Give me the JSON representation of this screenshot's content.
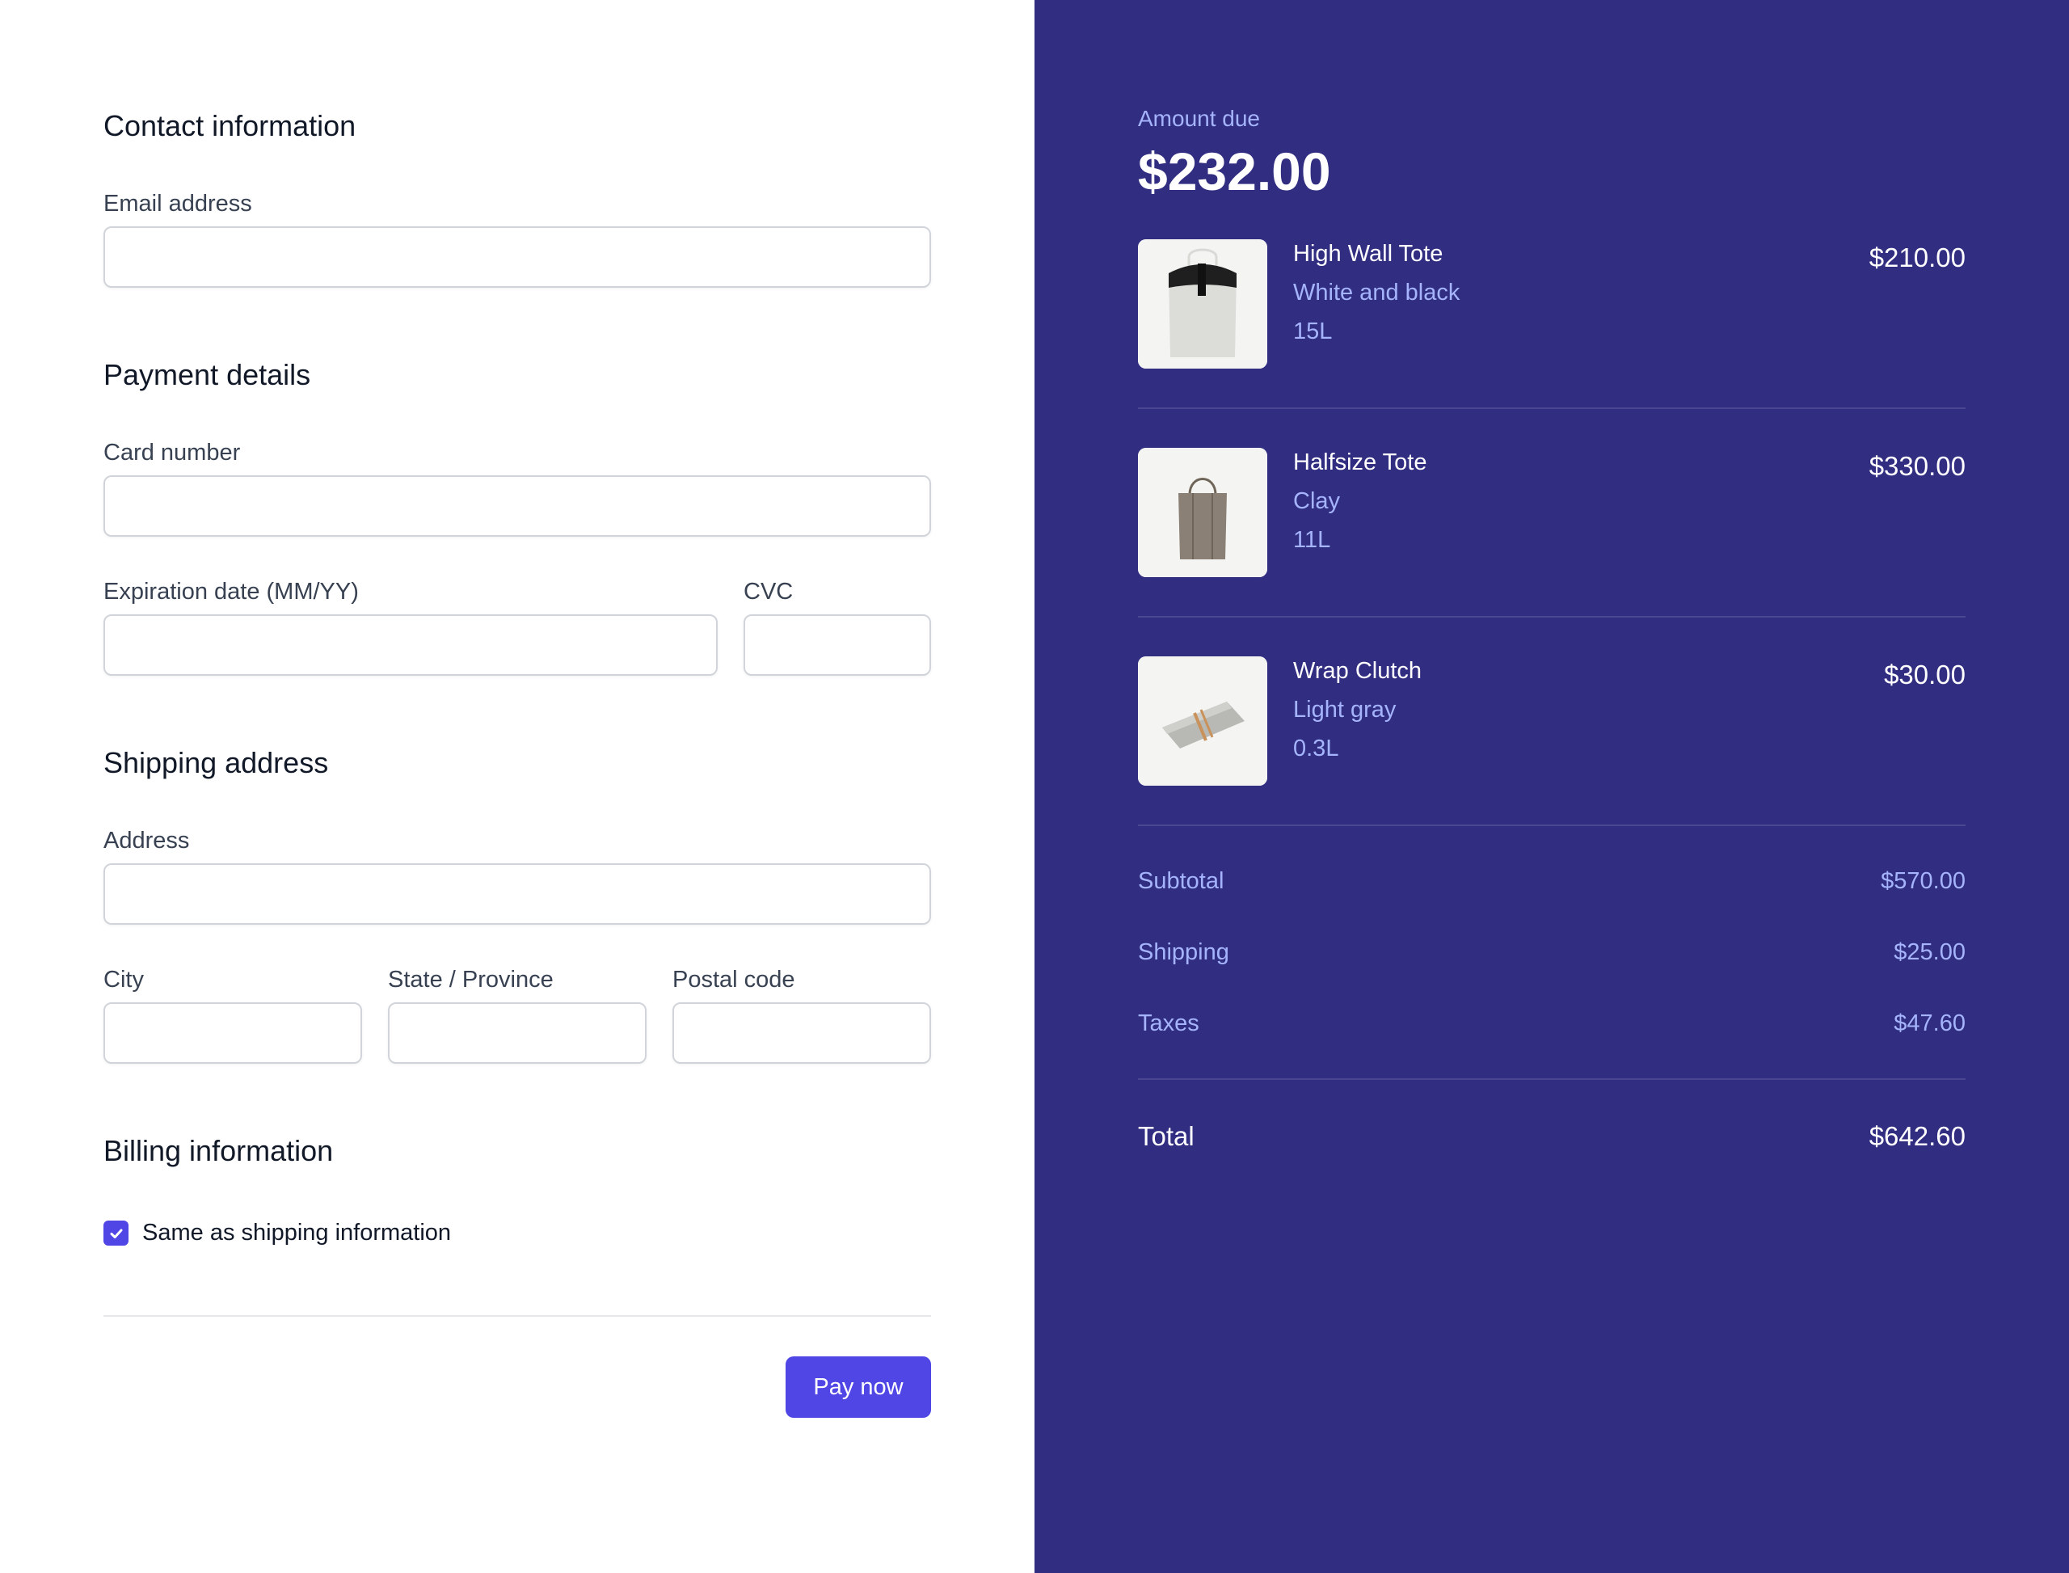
{
  "contact": {
    "title": "Contact information",
    "email_label": "Email address",
    "email_value": ""
  },
  "payment": {
    "title": "Payment details",
    "card_label": "Card number",
    "card_value": "",
    "exp_label": "Expiration date (MM/YY)",
    "exp_value": "",
    "cvc_label": "CVC",
    "cvc_value": ""
  },
  "shipping": {
    "title": "Shipping address",
    "address_label": "Address",
    "address_value": "",
    "city_label": "City",
    "city_value": "",
    "state_label": "State / Province",
    "state_value": "",
    "postal_label": "Postal code",
    "postal_value": ""
  },
  "billing": {
    "title": "Billing information",
    "same_as_shipping_label": "Same as shipping information",
    "same_as_shipping_checked": true
  },
  "actions": {
    "pay_label": "Pay now"
  },
  "summary": {
    "amount_due_label": "Amount due",
    "amount_due_value": "$232.00",
    "items": [
      {
        "name": "High Wall Tote",
        "variant": "White and black",
        "size": "15L",
        "price": "$210.00",
        "icon": "tote-bag-image"
      },
      {
        "name": "Halfsize Tote",
        "variant": "Clay",
        "size": "11L",
        "price": "$330.00",
        "icon": "halfsize-tote-image"
      },
      {
        "name": "Wrap Clutch",
        "variant": "Light gray",
        "size": "0.3L",
        "price": "$30.00",
        "icon": "clutch-image"
      }
    ],
    "subtotal_label": "Subtotal",
    "subtotal_value": "$570.00",
    "shipping_label": "Shipping",
    "shipping_value": "$25.00",
    "taxes_label": "Taxes",
    "taxes_value": "$47.60",
    "total_label": "Total",
    "total_value": "$642.60"
  },
  "colors": {
    "accent": "#4f46e5",
    "summary_bg": "#312e81",
    "summary_muted": "#a5b4fc"
  }
}
